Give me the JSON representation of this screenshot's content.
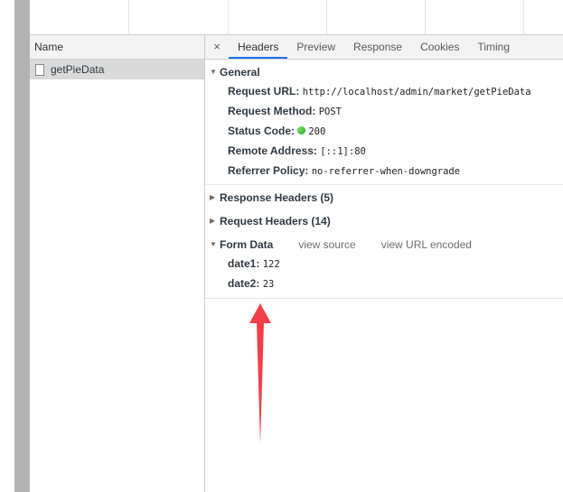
{
  "name_column": {
    "header": "Name",
    "requests": [
      {
        "name": "getPieData"
      }
    ]
  },
  "tabs": {
    "close": "×",
    "items": [
      "Headers",
      "Preview",
      "Response",
      "Cookies",
      "Timing"
    ],
    "active": "Headers"
  },
  "general": {
    "title": "General",
    "request_url": {
      "label": "Request URL:",
      "value": "http://localhost/admin/market/getPieData"
    },
    "request_method": {
      "label": "Request Method:",
      "value": "POST"
    },
    "status_code": {
      "label": "Status Code:",
      "value": "200"
    },
    "remote_address": {
      "label": "Remote Address:",
      "value": "[::1]:80"
    },
    "referrer_policy": {
      "label": "Referrer Policy:",
      "value": "no-referrer-when-downgrade"
    }
  },
  "response_headers": {
    "title": "Response Headers (5)"
  },
  "request_headers": {
    "title": "Request Headers (14)"
  },
  "form_data": {
    "title": "Form Data",
    "view_source": "view source",
    "view_url_encoded": "view URL encoded",
    "fields": [
      {
        "label": "date1:",
        "value": "122"
      },
      {
        "label": "date2:",
        "value": "23"
      }
    ]
  },
  "colors": {
    "annotation_arrow": "#f2404a",
    "status_ok": "#1b9e1b",
    "active_tab_underline": "#1a73e8"
  }
}
